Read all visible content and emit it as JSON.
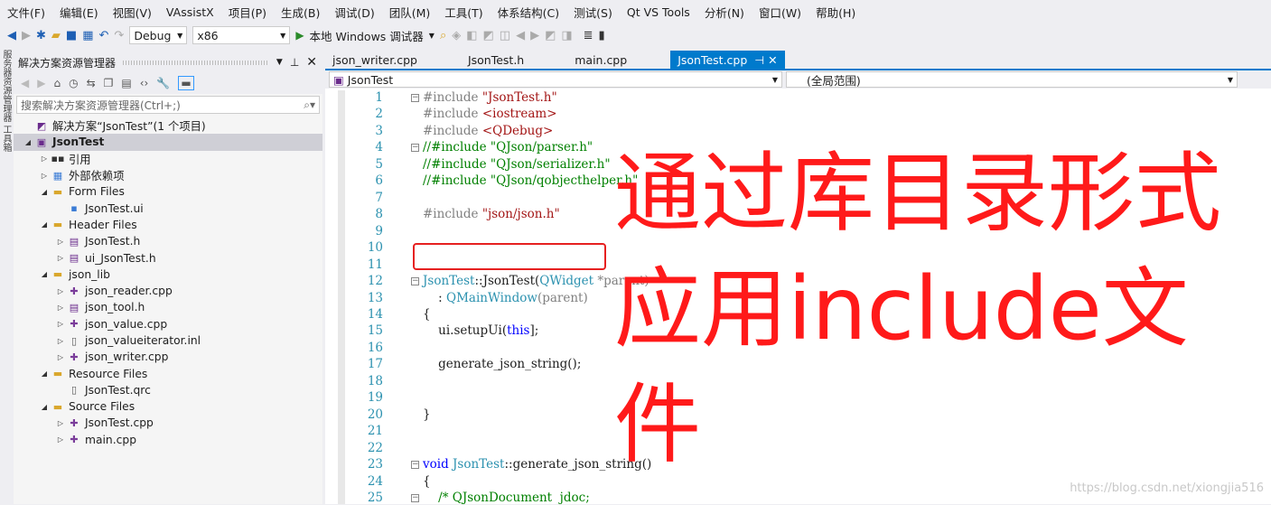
{
  "menu": [
    "文件(F)",
    "编辑(E)",
    "视图(V)",
    "VAssistX",
    "项目(P)",
    "生成(B)",
    "调试(D)",
    "团队(M)",
    "工具(T)",
    "体系结构(C)",
    "测试(S)",
    "Qt VS Tools",
    "分析(N)",
    "窗口(W)",
    "帮助(H)"
  ],
  "toolbar": {
    "config": "Debug",
    "platform": "x86",
    "run_label": "本地 Windows 调试器"
  },
  "side_strip": "服务器资源管理器 工具箱",
  "explorer": {
    "title": "解决方案资源管理器",
    "search_placeholder": "搜索解决方案资源管理器(Ctrl+;)",
    "items": [
      {
        "label": "解决方案“JsonTest”(1 个项目)",
        "depth": 0,
        "arrow": "",
        "icon": "solution-icon"
      },
      {
        "label": "JsonTest",
        "depth": 0,
        "arrow": "◢",
        "icon": "project-icon",
        "selected": true
      },
      {
        "label": "引用",
        "depth": 1,
        "arrow": "▷",
        "icon": "references-icon"
      },
      {
        "label": "外部依赖项",
        "depth": 1,
        "arrow": "▷",
        "icon": "external-deps-icon"
      },
      {
        "label": "Form Files",
        "depth": 1,
        "arrow": "◢",
        "icon": "folder-icon"
      },
      {
        "label": "JsonTest.ui",
        "depth": 2,
        "arrow": "",
        "icon": "ui-file-icon"
      },
      {
        "label": "Header Files",
        "depth": 1,
        "arrow": "◢",
        "icon": "folder-icon"
      },
      {
        "label": "JsonTest.h",
        "depth": 2,
        "arrow": "▷",
        "icon": "header-file-icon"
      },
      {
        "label": "ui_JsonTest.h",
        "depth": 2,
        "arrow": "▷",
        "icon": "header-file-icon"
      },
      {
        "label": "json_lib",
        "depth": 1,
        "arrow": "◢",
        "icon": "folder-icon"
      },
      {
        "label": "json_reader.cpp",
        "depth": 2,
        "arrow": "▷",
        "icon": "cpp-file-icon"
      },
      {
        "label": "json_tool.h",
        "depth": 2,
        "arrow": "▷",
        "icon": "header-file-icon"
      },
      {
        "label": "json_value.cpp",
        "depth": 2,
        "arrow": "▷",
        "icon": "cpp-file-icon"
      },
      {
        "label": "json_valueiterator.inl",
        "depth": 2,
        "arrow": "▷",
        "icon": "file-icon"
      },
      {
        "label": "json_writer.cpp",
        "depth": 2,
        "arrow": "▷",
        "icon": "cpp-file-icon"
      },
      {
        "label": "Resource Files",
        "depth": 1,
        "arrow": "◢",
        "icon": "folder-icon"
      },
      {
        "label": "JsonTest.qrc",
        "depth": 2,
        "arrow": "",
        "icon": "file-icon"
      },
      {
        "label": "Source Files",
        "depth": 1,
        "arrow": "◢",
        "icon": "folder-icon"
      },
      {
        "label": "JsonTest.cpp",
        "depth": 2,
        "arrow": "▷",
        "icon": "cpp-file-icon"
      },
      {
        "label": "main.cpp",
        "depth": 2,
        "arrow": "▷",
        "icon": "cpp-file-icon"
      }
    ]
  },
  "editor": {
    "tabs": [
      "json_writer.cpp",
      "JsonTest.h",
      "main.cpp",
      "JsonTest.cpp"
    ],
    "active_tab": 3,
    "nav_class": "JsonTest",
    "nav_scope": "(全局范围)",
    "lines": [
      [
        [
          "pp",
          "#include "
        ],
        [
          "str",
          "\"JsonTest.h\""
        ]
      ],
      [
        [
          "pp",
          "#include "
        ],
        [
          "str",
          "<iostream>"
        ]
      ],
      [
        [
          "pp",
          "#include "
        ],
        [
          "str",
          "<QDebug>"
        ]
      ],
      [
        [
          "cm",
          "//#include \"QJson/parser.h\""
        ]
      ],
      [
        [
          "cm",
          "//#include \"QJson/serializer.h\""
        ]
      ],
      [
        [
          "cm",
          "//#include \"QJson/qobjecthelper.h\""
        ]
      ],
      [],
      [
        [
          "pp",
          "#include "
        ],
        [
          "str",
          "\"json/json.h\""
        ]
      ],
      [],
      [],
      [],
      [
        [
          "ty",
          "JsonTest"
        ],
        [
          "",
          "::JsonTest("
        ],
        [
          "ty",
          "QWidget"
        ],
        [
          "pp",
          " *parent)"
        ]
      ],
      [
        [
          "",
          "    : "
        ],
        [
          "ty",
          "QMainWindow"
        ],
        [
          "pp",
          "(parent)"
        ]
      ],
      [
        [
          "",
          "{"
        ]
      ],
      [
        [
          "",
          "    ui.setupUi("
        ],
        [
          "kw",
          "this"
        ],
        [
          "",
          "];"
        ]
      ],
      [],
      [
        [
          "",
          "    generate_json_string();"
        ]
      ],
      [],
      [],
      [
        [
          "",
          "}"
        ]
      ],
      [],
      [],
      [
        [
          "kw",
          "void "
        ],
        [
          "ty",
          "JsonTest"
        ],
        [
          "",
          "::generate_json_string()"
        ]
      ],
      [
        [
          "",
          "{"
        ]
      ],
      [
        [
          "cm",
          "    /* QJsonDocument  jdoc;"
        ]
      ]
    ],
    "fold_lines": [
      1,
      4,
      12,
      23,
      25
    ]
  },
  "annotation": "通过库目录形式应用include文件",
  "watermark": "https://blog.csdn.net/xiongjia516"
}
